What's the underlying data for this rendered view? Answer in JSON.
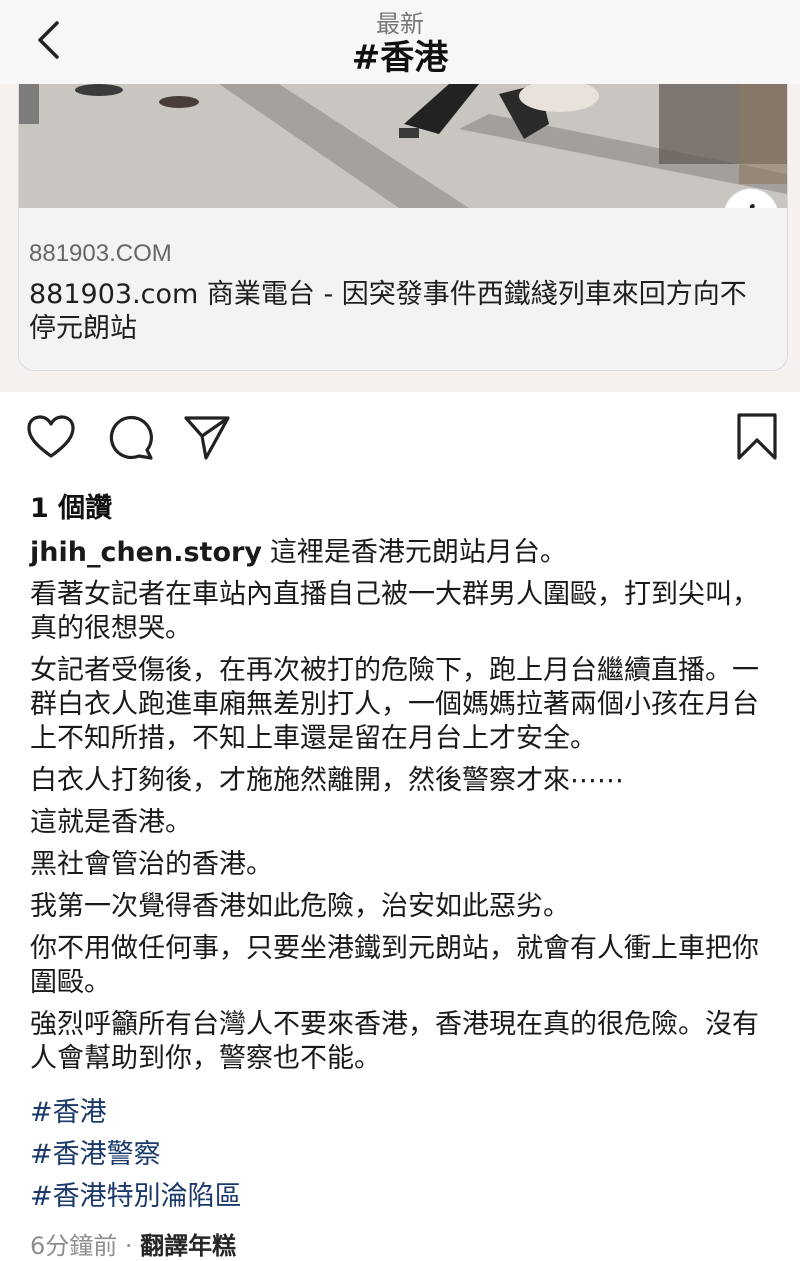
{
  "header": {
    "subtitle": "最新",
    "title": "#香港"
  },
  "link_preview": {
    "domain": "881903.COM",
    "title": "881903.com 商業電台 - 因突發事件西鐵綫列車來回方向不停元朗站",
    "info_icon": "i"
  },
  "actions": {
    "like_icon": "heart-icon",
    "comment_icon": "comment-icon",
    "share_icon": "send-icon",
    "save_icon": "bookmark-icon"
  },
  "likes": "1 個讚",
  "caption": {
    "username": "jhih_chen.story",
    "first_line": "這裡是香港元朗站月台。",
    "paragraphs": [
      "看著女記者在車站內直播自己被一大群男人圍毆，打到尖叫，真的很想哭。",
      "女記者受傷後，在再次被打的危險下，跑上月台繼續直播。一群白衣人跑進車廂無差別打人，一個媽媽拉著兩個小孩在月台上不知所措，不知上車還是留在月台上才安全。",
      "白衣人打夠後，才施施然離開，然後警察才來⋯⋯",
      "這就是香港。",
      "黑社會管治的香港。",
      "我第一次覺得香港如此危險，治安如此惡劣。",
      "你不用做任何事，只要坐港鐵到元朗站，就會有人衝上車把你圍毆。",
      "強烈呼籲所有台灣人不要來香港，香港現在真的很危險。沒有人會幫助到你，警察也不能。"
    ]
  },
  "hashtags": [
    "#香港",
    "#香港警察",
    "#香港特別淪陷區"
  ],
  "footer": {
    "time": "6分鐘前",
    "separator": " · ",
    "translate": "翻譯年糕"
  },
  "colors": {
    "hashtag": "#1b3a6b",
    "muted": "#8e8e8e",
    "preview_bg": "#f1f3f5"
  }
}
